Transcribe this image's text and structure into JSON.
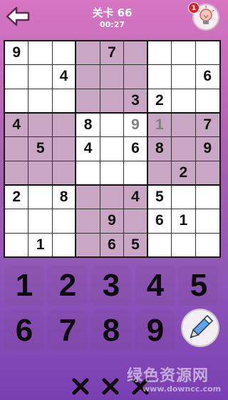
{
  "header": {
    "level_title": "关卡 66",
    "timer": "00:27",
    "hint_count": "1"
  },
  "board": {
    "rows": [
      [
        "9",
        "",
        "",
        "",
        "7",
        "",
        "",
        "",
        ""
      ],
      [
        "",
        "",
        "4",
        "",
        "",
        "",
        "",
        "",
        "6"
      ],
      [
        "",
        "",
        "",
        "",
        "",
        "3",
        "2",
        "",
        ""
      ],
      [
        "4",
        "",
        "",
        "8",
        "",
        "9",
        "1",
        "",
        "7"
      ],
      [
        "",
        "5",
        "",
        "4",
        "",
        "6",
        "8",
        "",
        "9"
      ],
      [
        "",
        "",
        "",
        "",
        "",
        "",
        "",
        "2",
        ""
      ],
      [
        "2",
        "",
        "8",
        "",
        "",
        "4",
        "5",
        "",
        ""
      ],
      [
        "",
        "",
        "",
        "",
        "9",
        "",
        "6",
        "1",
        ""
      ],
      [
        "",
        "1",
        "",
        "",
        "6",
        "5",
        "",
        "",
        ""
      ]
    ],
    "light_cells": [
      [
        3,
        5
      ],
      [
        3,
        6
      ]
    ],
    "colors": {
      "shaded": "#c9a6c4",
      "plain": "#ffffff",
      "digit": "#111111",
      "light_digit": "#808080"
    }
  },
  "keypad": {
    "keys": [
      "1",
      "2",
      "3",
      "4",
      "5",
      "6",
      "7",
      "8",
      "9"
    ]
  },
  "mistakes": {
    "marks": [
      "×",
      "×",
      "×"
    ]
  },
  "watermark": {
    "chinese": "绿色资源网",
    "url": "www.downcc.com"
  },
  "icons": {
    "back": "back-arrow-icon",
    "hint": "lightbulb-icon",
    "pencil": "pencil-icon",
    "mistake": "x-mark-icon"
  }
}
